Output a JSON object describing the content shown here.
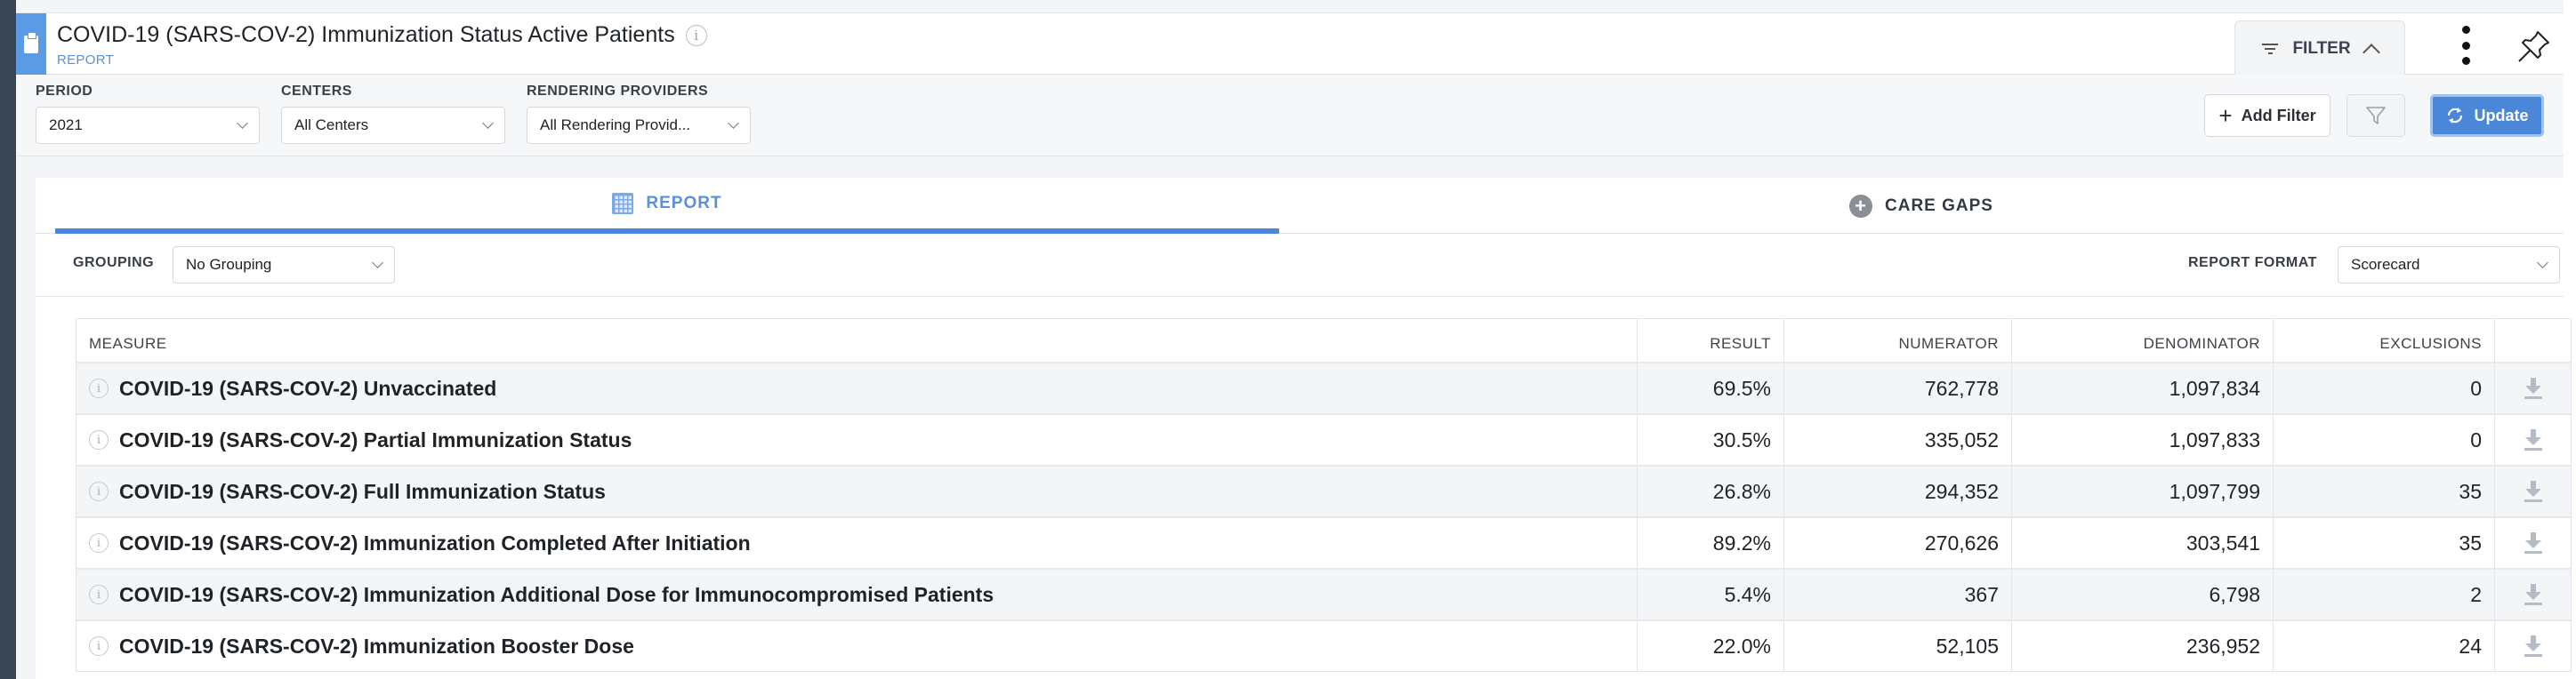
{
  "header": {
    "title": "COVID-19 (SARS-COV-2) Immunization Status Active Patients",
    "subtitle": "REPORT",
    "filter_toggle_label": "FILTER",
    "icons": [
      "clipboard-icon",
      "info-icon",
      "filter-lines-icon",
      "chevron-up-icon",
      "kebab-menu-icon",
      "pin-icon"
    ]
  },
  "filters": {
    "period": {
      "label": "PERIOD",
      "value": "2021"
    },
    "centers": {
      "label": "CENTERS",
      "value": "All Centers"
    },
    "rendering_providers": {
      "label": "RENDERING PROVIDERS",
      "value": "All Rendering Provid..."
    },
    "add_filter_label": "Add Filter",
    "update_label": "Update"
  },
  "tabs": [
    {
      "label": "REPORT",
      "icon": "table-icon",
      "active": true
    },
    {
      "label": "CARE GAPS",
      "icon": "plus-circle-icon",
      "active": false
    }
  ],
  "grouping": {
    "label": "GROUPING",
    "value": "No Grouping"
  },
  "report_format": {
    "label": "REPORT FORMAT",
    "value": "Scorecard"
  },
  "table": {
    "columns": [
      "MEASURE",
      "RESULT",
      "NUMERATOR",
      "DENOMINATOR",
      "EXCLUSIONS"
    ],
    "rows": [
      {
        "measure": "COVID-19 (SARS-COV-2) Unvaccinated",
        "result": "69.5%",
        "numerator": "762,778",
        "denominator": "1,097,834",
        "exclusions": "0"
      },
      {
        "measure": "COVID-19 (SARS-COV-2) Partial Immunization Status",
        "result": "30.5%",
        "numerator": "335,052",
        "denominator": "1,097,833",
        "exclusions": "0"
      },
      {
        "measure": "COVID-19 (SARS-COV-2) Full Immunization Status",
        "result": "26.8%",
        "numerator": "294,352",
        "denominator": "1,097,799",
        "exclusions": "35"
      },
      {
        "measure": "COVID-19 (SARS-COV-2) Immunization Completed After Initiation",
        "result": "89.2%",
        "numerator": "270,626",
        "denominator": "303,541",
        "exclusions": "35"
      },
      {
        "measure": "COVID-19 (SARS-COV-2) Immunization Additional Dose for Immunocompromised Patients",
        "result": "5.4%",
        "numerator": "367",
        "denominator": "6,798",
        "exclusions": "2"
      },
      {
        "measure": "COVID-19 (SARS-COV-2) Immunization Booster Dose",
        "result": "22.0%",
        "numerator": "52,105",
        "denominator": "236,952",
        "exclusions": "24"
      }
    ]
  },
  "colors": {
    "accent": "#5b9be6",
    "primary_button": "#4a87d8",
    "rail": "#3b4654"
  }
}
